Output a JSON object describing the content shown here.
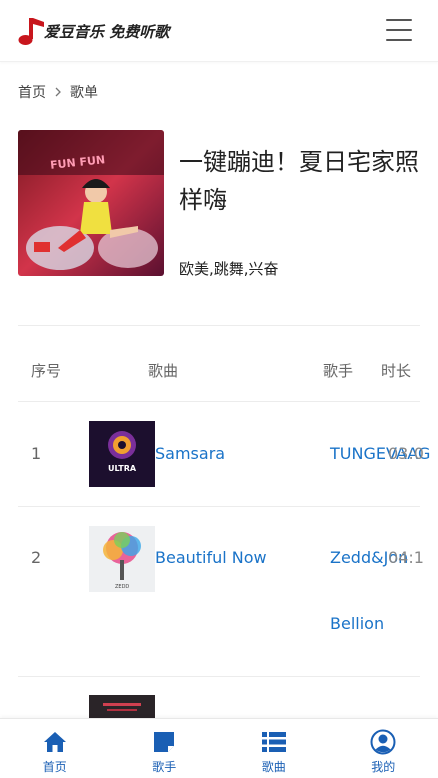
{
  "app": {
    "logo_text": "爱豆音乐 免费听歌",
    "brand_color": "#c8161d",
    "link_color": "#1a73c8",
    "nav_color": "#1a5fb4"
  },
  "breadcrumb": {
    "home": "首页",
    "current": "歌单"
  },
  "playlist": {
    "title": "一键蹦迪！夏日宅家照样嗨",
    "tags": "欧美,跳舞,兴奋",
    "cover_text": "FUN FUN"
  },
  "table": {
    "headers": {
      "index": "序号",
      "song": "歌曲",
      "artist": "歌手",
      "duration": "时长"
    },
    "rows": [
      {
        "index": "1",
        "song": "Samsara",
        "artist": "TUNGEVAAG",
        "duration": "03:0",
        "thumb_text": "ULTRA"
      },
      {
        "index": "2",
        "song": "Beautiful Now",
        "artist": "Zedd&Jon",
        "artist_line2": "Bellion",
        "duration": "04:1",
        "thumb_text": "ZEDD"
      },
      {
        "index": "3",
        "song": "",
        "artist": "",
        "duration": ""
      }
    ]
  },
  "bottom_nav": [
    {
      "label": "首页",
      "icon": "home-icon"
    },
    {
      "label": "歌手",
      "icon": "artist-icon"
    },
    {
      "label": "歌曲",
      "icon": "list-icon"
    },
    {
      "label": "我的",
      "icon": "user-icon"
    }
  ]
}
